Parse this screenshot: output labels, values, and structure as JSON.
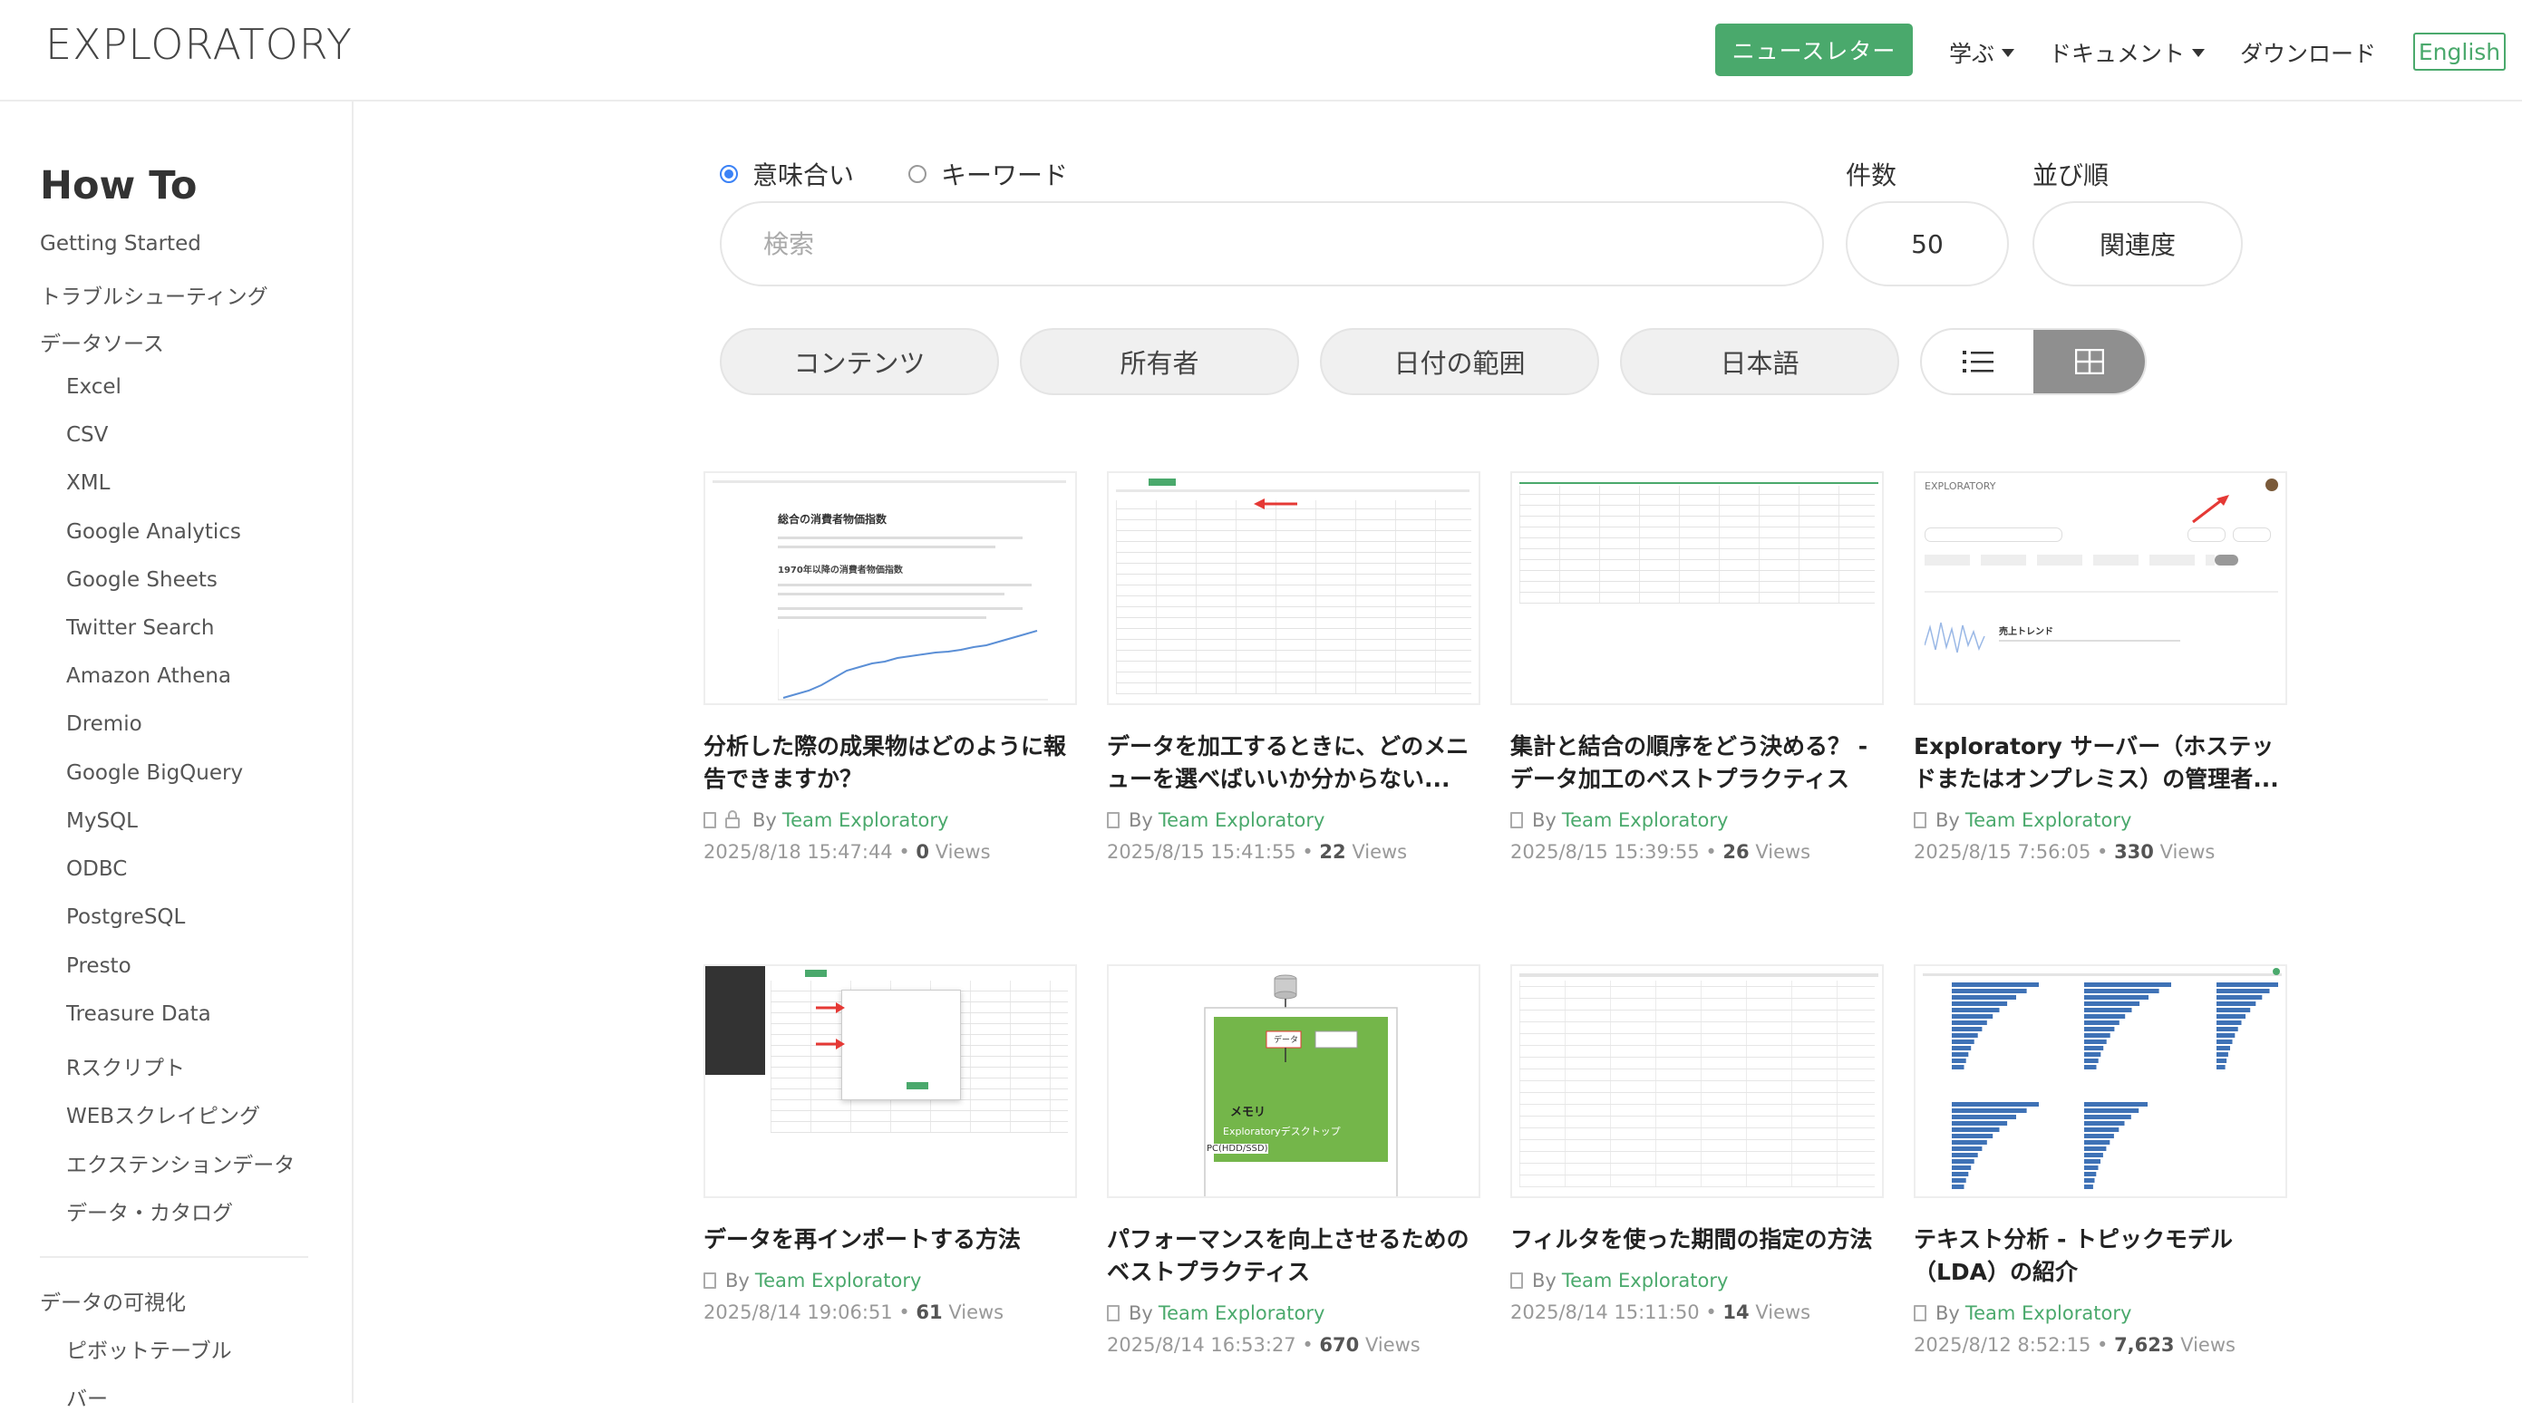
{
  "header": {
    "logo": "EXPLORATORY",
    "newsletter": "ニュースレター",
    "learn": "学ぶ",
    "docs": "ドキュメント",
    "download": "ダウンロード",
    "language": "English"
  },
  "sidebar": {
    "title": "How To",
    "items": [
      "Getting Started",
      "トラブルシューティング",
      "データソース",
      "Excel",
      "CSV",
      "XML",
      "Google Analytics",
      "Google Sheets",
      "Twitter Search",
      "Amazon Athena",
      "Dremio",
      "Google BigQuery",
      "MySQL",
      "ODBC",
      "PostgreSQL",
      "Presto",
      "Treasure Data",
      "Rスクリプト",
      "WEBスクレイピング",
      "エクステンションデータ",
      "データ・カタログ",
      "データの可視化",
      "ピボットテーブル",
      "バー"
    ]
  },
  "search": {
    "mode_semantic": "意味合い",
    "mode_keyword": "キーワード",
    "placeholder": "検索",
    "count_label": "件数",
    "count_value": "50",
    "sort_label": "並び順",
    "sort_value": "関連度"
  },
  "filters": [
    "コンテンツ",
    "所有者",
    "日付の範囲",
    "日本語"
  ],
  "by": "By",
  "views_label": "Views",
  "cards": [
    {
      "title": "分析した際の成果物はどのように報告できますか？",
      "owner": "Team Exploratory",
      "date": "2025/8/18 15:47:44",
      "views": "0"
    },
    {
      "title": "データを加工するときに、どのメニューを選べばいいか分からない...",
      "owner": "Team Exploratory",
      "date": "2025/8/15 15:41:55",
      "views": "22"
    },
    {
      "title": "集計と結合の順序をどう決める？ - データ加工のベストプラクティス",
      "owner": "Team Exploratory",
      "date": "2025/8/15 15:39:55",
      "views": "26"
    },
    {
      "title": "Exploratory サーバー（ホステッドまたはオンプレミス）の管理者...",
      "owner": "Team Exploratory",
      "date": "2025/8/15 7:56:05",
      "views": "330"
    },
    {
      "title": "データを再インポートする方法",
      "owner": "Team Exploratory",
      "date": "2025/8/14 19:06:51",
      "views": "61"
    },
    {
      "title": "パフォーマンスを向上させるためのベストプラクティス",
      "owner": "Team Exploratory",
      "date": "2025/8/14 16:53:27",
      "views": "670"
    },
    {
      "title": "フィルタを使った期間の指定の方法",
      "owner": "Team Exploratory",
      "date": "2025/8/14 15:11:50",
      "views": "14"
    },
    {
      "title": "テキスト分析 - トピックモデル（LDA）の紹介",
      "owner": "Team Exploratory",
      "date": "2025/8/12 8:52:15",
      "views": "7,623"
    }
  ],
  "thumbs": {
    "t1_title": "総合の消費者物価指数",
    "t1_sub": "1970年以降の消費者物価指数",
    "t4_logo": "EXPLORATORY",
    "t4_heading": "売上トレンド",
    "t6_data": "データ",
    "t6_memory": "メモリ",
    "t6_app": "Exploratoryデスクトップ",
    "t6_pc": "PC(HDD/SSD)"
  },
  "colors": {
    "brand": "#4aa96c",
    "radio": "#3b82f6",
    "bar": "#3f72b6"
  }
}
